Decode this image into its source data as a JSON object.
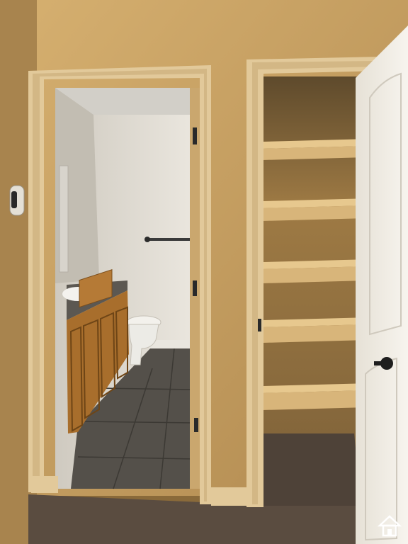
{
  "scene": {
    "wall": "#c9a264",
    "wall_shadow": "#8f6d3c",
    "trim": "#e2c99a",
    "trim_shadow": "#b89868",
    "carpet": "#5a4c40",
    "tile": "#54504a",
    "bathroom_wall": "#e6e2da",
    "bathroom_ceiling": "#d2cfc8",
    "cabinet": "#a86e2c",
    "countertop": "#5c5852",
    "closet_interior": "#9e7a44",
    "shelf": "#d8b57a",
    "door": "#f2efe8",
    "hardware": "#1e1e1e"
  },
  "closet": {
    "shelf_count": 5
  },
  "watermark": {
    "logo": "house-logo-icon"
  }
}
